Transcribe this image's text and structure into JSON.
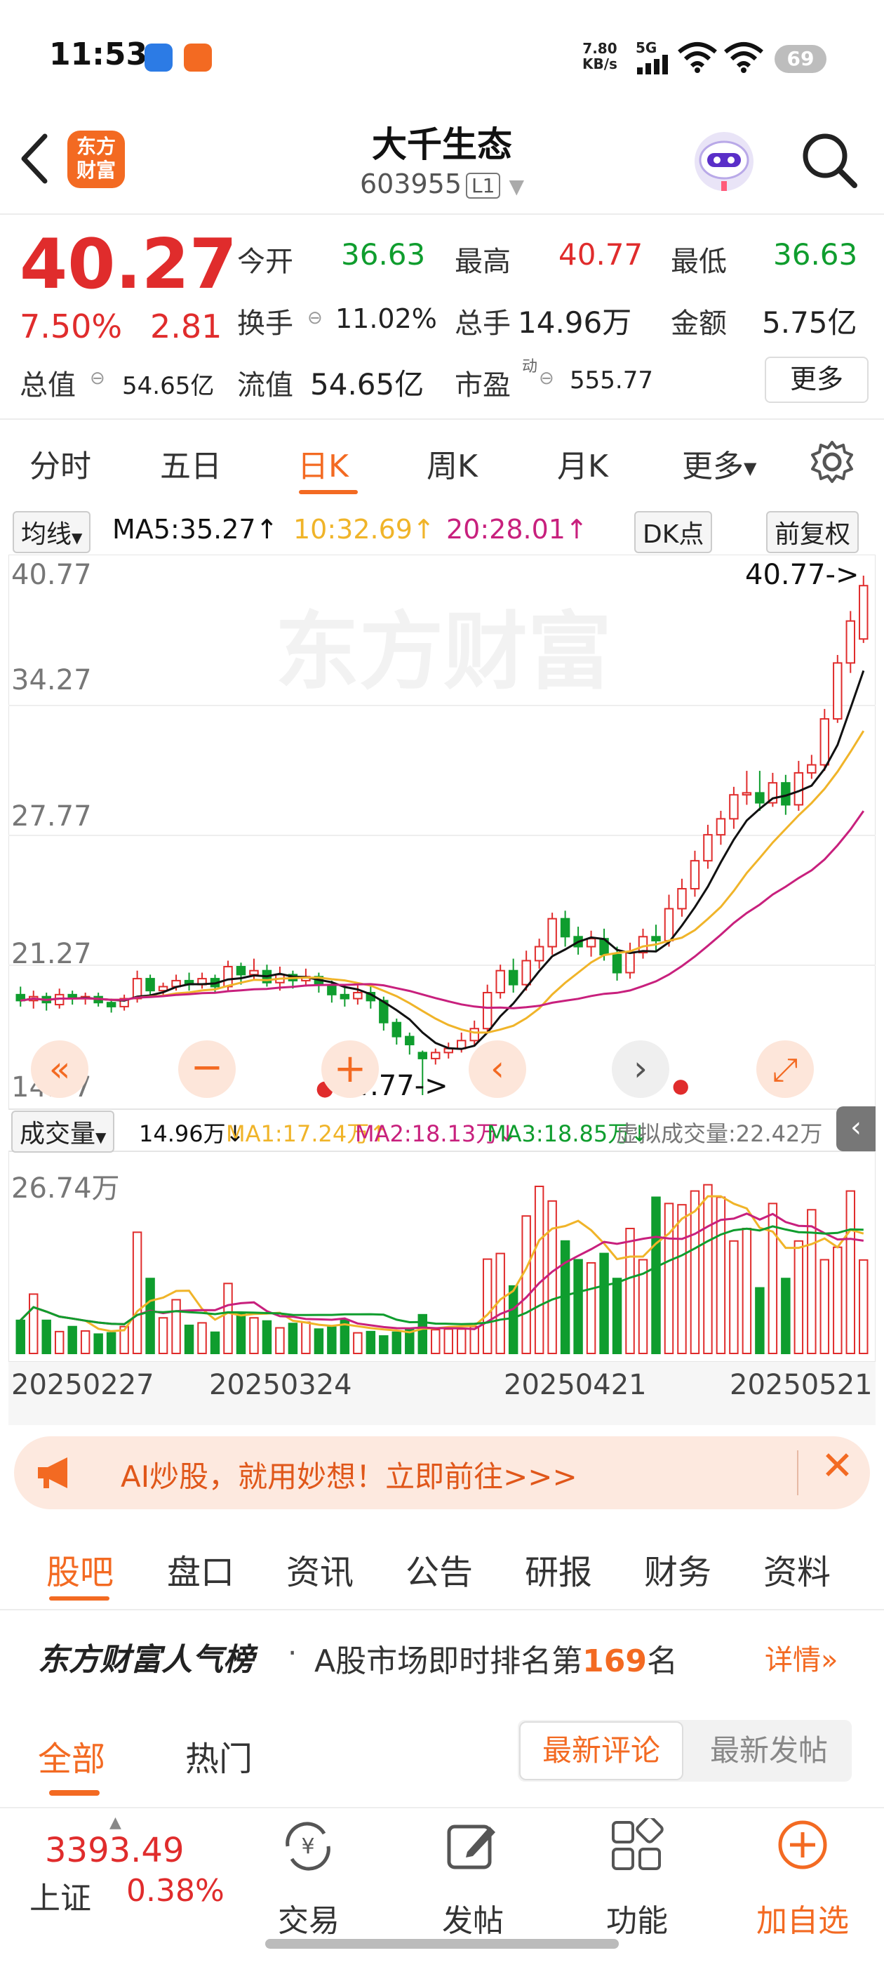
{
  "status_bar": {
    "time": "11:53",
    "net_speed_top": "7.80",
    "net_speed_bottom": "KB/s",
    "network": "5G",
    "battery": "69"
  },
  "header": {
    "brand_logo_text_1": "东方",
    "brand_logo_text_2": "财富",
    "stock_name": "大千生态",
    "stock_code": "603955",
    "level_tag": "L1"
  },
  "quote": {
    "price": "40.27",
    "change_pct": "7.50%",
    "change": "2.81",
    "open_label": "今开",
    "open": "36.63",
    "high_label": "最高",
    "high": "40.77",
    "low_label": "最低",
    "low": "36.63",
    "turnover_label": "换手",
    "turnover": "11.02%",
    "volume_label": "总手",
    "volume": "14.96万",
    "amount_label": "金额",
    "amount": "5.75亿",
    "mcap_label": "总值",
    "mcap": "54.65亿",
    "float_label": "流值",
    "float": "54.65亿",
    "pe_label": "市盈",
    "pe_sup": "动",
    "pe": "555.77",
    "more_button": "更多"
  },
  "chart_tabs": [
    "分时",
    "五日",
    "日K",
    "周K",
    "月K",
    "更多"
  ],
  "active_tab": "日K",
  "ma_bar": {
    "ma_selector": "均线",
    "ma5": "MA5:35.27",
    "ma10": "10:32.69",
    "ma20": "20:28.01",
    "dk_button": "DK点",
    "adjust_button": "前复权"
  },
  "volume_bar": {
    "selector": "成交量",
    "vol": "14.96万",
    "ma1": "MA1:17.24万",
    "ma2": "MA2:18.13万",
    "ma3": "MA3:18.85万",
    "virtual": "虚拟成交量:22.42万"
  },
  "watermark": "东方财富",
  "colors": {
    "up": "#e02c2c",
    "down": "#0f9d2e",
    "ma5": "#111111",
    "ma10": "#f0b429",
    "ma20": "#c8207d",
    "accent": "#f36a22"
  },
  "chart_data": {
    "type": "candlestick",
    "price_axis_ticks": [
      "40.77",
      "34.27",
      "27.77",
      "21.27",
      "14.77"
    ],
    "ylim": [
      14.77,
      40.77
    ],
    "max_annotation": "40.77->",
    "min_annotation": "14.77->",
    "volume_axis_label": "26.74万",
    "date_ticks": [
      "20250227",
      "20250324",
      "20250421",
      "20250521"
    ],
    "candles": [
      [
        19.8,
        19.5,
        20.2,
        19.2
      ],
      [
        19.5,
        19.7,
        20.0,
        19.1
      ],
      [
        19.7,
        19.4,
        19.9,
        19.0
      ],
      [
        19.3,
        19.8,
        20.1,
        19.1
      ],
      [
        19.8,
        19.6,
        20.0,
        19.3
      ],
      [
        19.6,
        19.7,
        19.9,
        19.3
      ],
      [
        19.7,
        19.4,
        19.9,
        19.2
      ],
      [
        19.4,
        19.2,
        19.6,
        18.9
      ],
      [
        19.2,
        19.6,
        19.8,
        19.0
      ],
      [
        19.6,
        20.6,
        21.0,
        19.4
      ],
      [
        20.6,
        20.0,
        20.8,
        19.7
      ],
      [
        20.0,
        20.2,
        20.4,
        19.8
      ],
      [
        20.2,
        20.5,
        20.8,
        20.0
      ],
      [
        20.5,
        20.3,
        20.9,
        20.0
      ],
      [
        20.3,
        20.6,
        20.9,
        20.1
      ],
      [
        20.6,
        20.2,
        20.8,
        19.9
      ],
      [
        20.2,
        21.2,
        21.5,
        20.0
      ],
      [
        21.2,
        20.8,
        21.4,
        20.3
      ],
      [
        20.8,
        21.0,
        21.6,
        20.5
      ],
      [
        21.0,
        20.4,
        21.3,
        20.2
      ],
      [
        20.4,
        20.8,
        21.2,
        20.0
      ],
      [
        20.8,
        20.5,
        21.0,
        20.1
      ],
      [
        20.5,
        20.7,
        21.1,
        20.2
      ],
      [
        20.7,
        20.3,
        20.9,
        19.9
      ],
      [
        20.3,
        19.8,
        20.5,
        19.4
      ],
      [
        19.8,
        19.6,
        20.2,
        19.2
      ],
      [
        19.6,
        19.9,
        20.3,
        19.3
      ],
      [
        19.9,
        19.5,
        20.2,
        19.1
      ],
      [
        19.5,
        18.4,
        19.7,
        18.0
      ],
      [
        18.4,
        17.7,
        18.6,
        17.3
      ],
      [
        17.7,
        17.3,
        17.9,
        16.8
      ],
      [
        16.9,
        16.6,
        17.0,
        14.77
      ],
      [
        16.6,
        16.9,
        17.1,
        16.3
      ],
      [
        16.9,
        17.1,
        17.4,
        16.6
      ],
      [
        17.1,
        17.5,
        17.9,
        16.9
      ],
      [
        17.5,
        18.1,
        18.5,
        17.2
      ],
      [
        18.1,
        19.9,
        20.3,
        17.9
      ],
      [
        19.9,
        21.0,
        21.3,
        19.6
      ],
      [
        21.0,
        20.3,
        21.6,
        19.9
      ],
      [
        20.3,
        21.5,
        22.0,
        20.0
      ],
      [
        21.5,
        22.2,
        22.6,
        21.1
      ],
      [
        22.2,
        23.6,
        23.9,
        21.8
      ],
      [
        23.6,
        22.7,
        24.0,
        22.2
      ],
      [
        22.7,
        22.2,
        23.2,
        21.8
      ],
      [
        22.2,
        22.6,
        23.0,
        21.7
      ],
      [
        22.6,
        21.8,
        23.1,
        21.5
      ],
      [
        21.8,
        20.9,
        22.2,
        20.5
      ],
      [
        20.9,
        21.9,
        22.4,
        20.6
      ],
      [
        21.9,
        22.7,
        23.1,
        21.6
      ],
      [
        22.7,
        22.5,
        23.3,
        22.0
      ],
      [
        22.5,
        24.1,
        24.8,
        22.2
      ],
      [
        24.1,
        25.1,
        25.6,
        23.7
      ],
      [
        25.1,
        26.5,
        27.0,
        24.7
      ],
      [
        26.5,
        27.8,
        28.3,
        26.1
      ],
      [
        27.8,
        28.6,
        29.0,
        27.3
      ],
      [
        28.6,
        29.8,
        30.2,
        28.1
      ],
      [
        29.8,
        29.9,
        31.0,
        29.3
      ],
      [
        29.9,
        29.4,
        31.0,
        29.0
      ],
      [
        29.4,
        30.4,
        30.9,
        29.2
      ],
      [
        30.4,
        29.3,
        30.8,
        28.8
      ],
      [
        29.3,
        30.9,
        31.5,
        29.0
      ],
      [
        30.9,
        31.3,
        31.8,
        30.6
      ],
      [
        31.3,
        33.6,
        34.1,
        31.0
      ],
      [
        33.6,
        36.4,
        36.8,
        33.4
      ],
      [
        36.4,
        38.5,
        39.0,
        35.9
      ],
      [
        37.6,
        40.27,
        40.77,
        37.4
      ]
    ],
    "volumes": [
      5.3,
      9.5,
      5.3,
      3.5,
      4.3,
      3.6,
      3.1,
      3.3,
      4.3,
      19.4,
      12.0,
      5.7,
      8.6,
      4.5,
      4.9,
      3.4,
      11.2,
      6.4,
      5.7,
      5.2,
      4.1,
      4.8,
      5.0,
      3.9,
      4.2,
      5.4,
      3.3,
      3.5,
      2.8,
      3.4,
      3.9,
      6.2,
      3.8,
      3.9,
      3.9,
      4.3,
      15.1,
      16.0,
      10.8,
      22.0,
      26.74,
      24.4,
      18.0,
      15.0,
      14.5,
      16.0,
      12.0,
      20.0,
      15.0,
      25.0,
      24.0,
      23.8,
      26.0,
      27.0,
      25.0,
      18.0,
      20.0,
      10.5,
      24.0,
      12.0,
      18.0,
      23.0,
      15.0,
      17.0,
      26.0,
      14.96
    ]
  },
  "ad_banner": {
    "text": "AI炒股，就用妙想！立即前往>>>"
  },
  "bottom_tabs": [
    "股吧",
    "盘口",
    "资讯",
    "公告",
    "研报",
    "财务",
    "资料"
  ],
  "ranking": {
    "title": "东方财富人气榜",
    "dot": "·",
    "text_before": "A股市场即时排名第",
    "rank": "169",
    "text_after": "名",
    "detail": "详情"
  },
  "feed_tabs": [
    "全部",
    "热门"
  ],
  "sort_options": [
    "最新评论",
    "最新发帖"
  ],
  "footer": {
    "index_value": "3393.49",
    "index_name": "上证",
    "index_change": "0.38%",
    "nav": [
      {
        "label": "交易",
        "icon": "yuan-exchange-icon"
      },
      {
        "label": "发帖",
        "icon": "edit-icon"
      },
      {
        "label": "功能",
        "icon": "grid-icon"
      },
      {
        "label": "加自选",
        "icon": "plus-circle-icon"
      }
    ]
  }
}
